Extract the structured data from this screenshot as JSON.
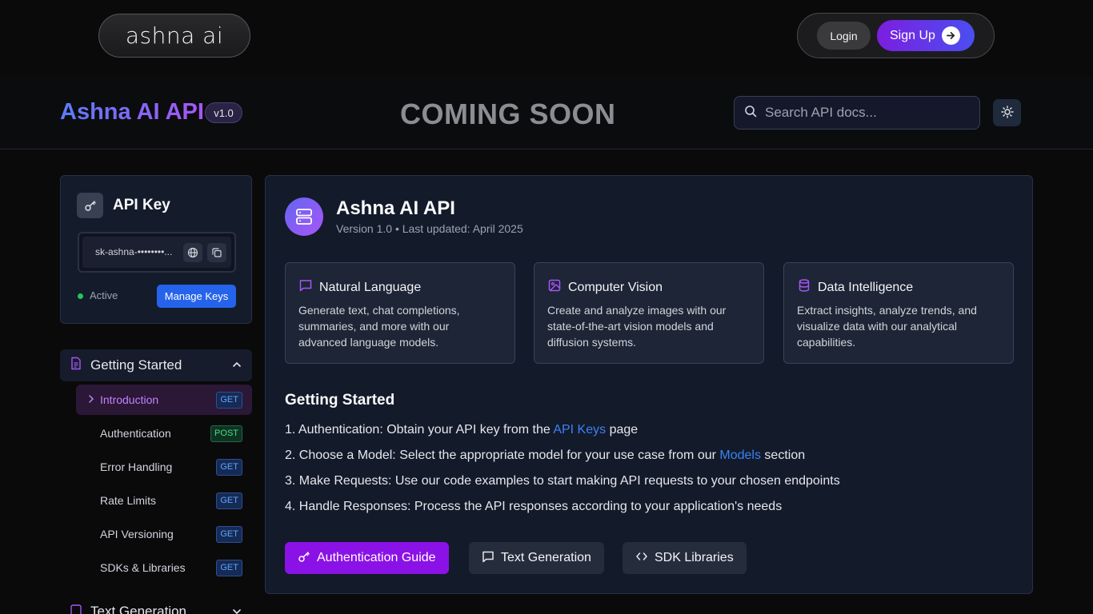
{
  "topnav": {
    "logo": "ashna ai",
    "login_label": "Login",
    "signup_label": "Sign Up"
  },
  "header": {
    "title": "Ashna AI API",
    "version": "v1.0",
    "banner": "COMING SOON",
    "search_placeholder": "Search API docs..."
  },
  "api_key": {
    "title": "API Key",
    "value": "sk-ashna-••••••••...",
    "status": "Active",
    "manage_label": "Manage Keys",
    "status_color": "#22c55e"
  },
  "sidebar": {
    "section": "Getting Started",
    "items": [
      {
        "label": "Introduction",
        "method": "GET"
      },
      {
        "label": "Authentication",
        "method": "POST"
      },
      {
        "label": "Error Handling",
        "method": "GET"
      },
      {
        "label": "Rate Limits",
        "method": "GET"
      },
      {
        "label": "API Versioning",
        "method": "GET"
      },
      {
        "label": "SDKs & Libraries",
        "method": "GET"
      }
    ],
    "next_section": "Text Generation"
  },
  "main": {
    "title": "Ashna AI API",
    "subtitle": "Version 1.0 • Last updated: April 2025",
    "features": [
      {
        "icon": "chat-icon",
        "title": "Natural Language",
        "desc": "Generate text, chat completions, summaries, and more with our advanced language models."
      },
      {
        "icon": "image-icon",
        "title": "Computer Vision",
        "desc": "Create and analyze images with our state-of-the-art vision models and diffusion systems."
      },
      {
        "icon": "database-icon",
        "title": "Data Intelligence",
        "desc": "Extract insights, analyze trends, and visualize data with our analytical capabilities."
      }
    ],
    "getting_started_title": "Getting Started",
    "steps": [
      {
        "pre": "1. Authentication: Obtain your API key from the ",
        "link": "API Keys",
        "post": " page"
      },
      {
        "pre": "2. Choose a Model: Select the appropriate model for your use case from our ",
        "link": "Models",
        "post": " section"
      },
      {
        "pre": "3. Make Requests: Use our code examples to start making API requests to your chosen endpoints",
        "link": "",
        "post": ""
      },
      {
        "pre": "4. Handle Responses: Process the API responses according to your application's needs",
        "link": "",
        "post": ""
      }
    ],
    "buttons": {
      "auth_guide": "Authentication Guide",
      "text_generation": "Text Generation",
      "sdk_libraries": "SDK Libraries"
    }
  },
  "colors": {
    "accent": "#8b12e6",
    "link": "#3b82f6",
    "get_badge": "#60a5fa",
    "post_badge": "#4ade80"
  }
}
